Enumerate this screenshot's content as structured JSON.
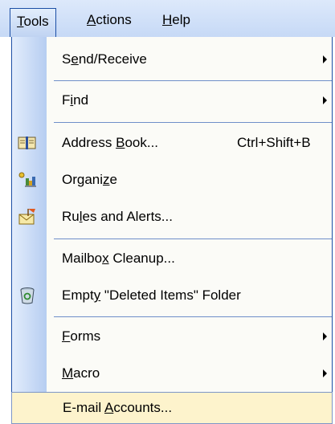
{
  "menubar": {
    "items": [
      {
        "pre": "",
        "acc": "T",
        "post": "ools",
        "active": true
      },
      {
        "pre": "",
        "acc": "A",
        "post": "ctions",
        "active": false
      },
      {
        "pre": "",
        "acc": "H",
        "post": "elp",
        "active": false
      }
    ]
  },
  "tools_menu": {
    "items": [
      {
        "pre": "S",
        "acc": "e",
        "post": "nd/Receive",
        "shortcut": "",
        "submenu": true,
        "icon": ""
      },
      {
        "pre": "F",
        "acc": "i",
        "post": "nd",
        "shortcut": "",
        "submenu": true,
        "icon": ""
      },
      {
        "pre": "Address ",
        "acc": "B",
        "post": "ook...",
        "shortcut": "Ctrl+Shift+B",
        "submenu": false,
        "icon": "address-book-icon"
      },
      {
        "pre": "Organi",
        "acc": "z",
        "post": "e",
        "shortcut": "",
        "submenu": false,
        "icon": "organize-icon"
      },
      {
        "pre": "Ru",
        "acc": "l",
        "post": "es and Alerts...",
        "shortcut": "",
        "submenu": false,
        "icon": "rules-alerts-icon"
      },
      {
        "pre": "Mailbo",
        "acc": "x",
        "post": " Cleanup...",
        "shortcut": "",
        "submenu": false,
        "icon": ""
      },
      {
        "pre": "Empt",
        "acc": "y",
        "post": " \"Deleted Items\" Folder",
        "shortcut": "",
        "submenu": false,
        "icon": "recycle-bin-icon"
      },
      {
        "pre": "",
        "acc": "F",
        "post": "orms",
        "shortcut": "",
        "submenu": true,
        "icon": ""
      },
      {
        "pre": "",
        "acc": "M",
        "post": "acro",
        "shortcut": "",
        "submenu": true,
        "icon": ""
      },
      {
        "pre": "E-mail ",
        "acc": "A",
        "post": "ccounts...",
        "shortcut": "",
        "submenu": false,
        "icon": "",
        "highlighted": true
      }
    ]
  },
  "colors": {
    "menubar_bg": "#c6d9f6",
    "border": "#1c4fa5",
    "highlight": "#fdf3cc"
  }
}
